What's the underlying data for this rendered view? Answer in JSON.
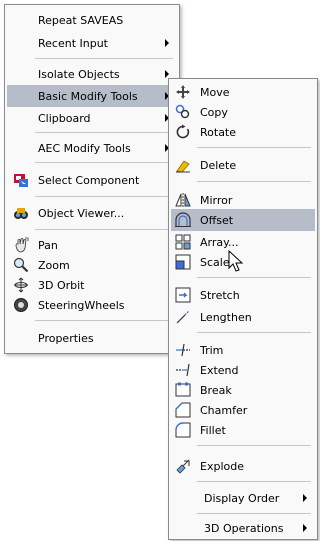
{
  "menu1": {
    "items": [
      {
        "label": "Repeat SAVEAS"
      },
      {
        "label": "Recent Input"
      },
      {
        "label": "Isolate Objects"
      },
      {
        "label": "Basic Modify Tools"
      },
      {
        "label": "Clipboard"
      },
      {
        "label": "AEC Modify Tools"
      },
      {
        "label": "Select Component"
      },
      {
        "label": "Object Viewer..."
      },
      {
        "label": "Pan"
      },
      {
        "label": "Zoom"
      },
      {
        "label": "3D Orbit"
      },
      {
        "label": "SteeringWheels"
      },
      {
        "label": "Properties"
      }
    ]
  },
  "menu2": {
    "items": [
      {
        "label": "Move"
      },
      {
        "label": "Copy"
      },
      {
        "label": "Rotate"
      },
      {
        "label": "Delete"
      },
      {
        "label": "Mirror"
      },
      {
        "label": "Offset"
      },
      {
        "label": "Array..."
      },
      {
        "label": "Scale"
      },
      {
        "label": "Stretch"
      },
      {
        "label": "Lengthen"
      },
      {
        "label": "Trim"
      },
      {
        "label": "Extend"
      },
      {
        "label": "Break"
      },
      {
        "label": "Chamfer"
      },
      {
        "label": "Fillet"
      },
      {
        "label": "Explode"
      },
      {
        "label": "Display Order"
      },
      {
        "label": "3D Operations"
      }
    ]
  },
  "colors": {
    "highlight": "#b6bdc8",
    "menu_bg": "#f9f9f9"
  }
}
